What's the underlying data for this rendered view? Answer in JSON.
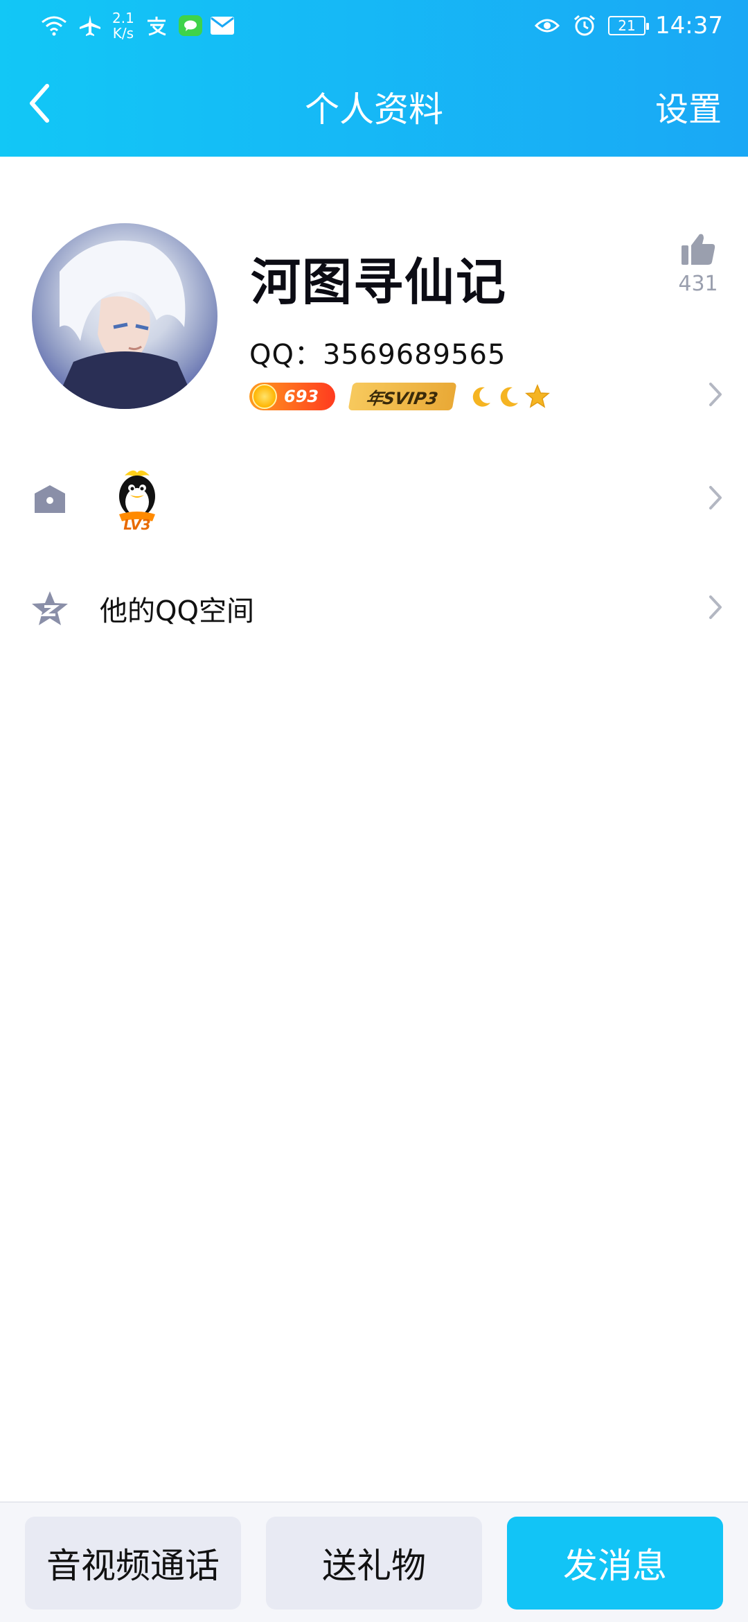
{
  "status_bar": {
    "net_speed_value": "2.1",
    "net_speed_unit": "K/s",
    "battery": "21",
    "time": "14:37",
    "icons_left": [
      "wifi-icon",
      "airplane-icon",
      "alipay-icon",
      "message-icon",
      "mail-icon"
    ],
    "icons_right": [
      "eye-icon",
      "alarm-icon",
      "battery-icon"
    ]
  },
  "navbar": {
    "title": "个人资料",
    "settings_label": "设置"
  },
  "profile": {
    "nickname": "河图寻仙记",
    "qq_label": "QQ：3569689565",
    "like_count": "431",
    "coin_badge": "693",
    "svip_badge": "年SVIP3",
    "level_icons": [
      "moon",
      "moon",
      "star"
    ]
  },
  "rows": {
    "qq_level_text": "LV3",
    "qzone_label": "他的QQ空间"
  },
  "bottom_bar": {
    "call_label": "音视频通话",
    "gift_label": "送礼物",
    "message_label": "发消息"
  },
  "colors": {
    "header_start": "#12c7f6",
    "header_end": "#1aa8f5",
    "primary_button": "#12c4f6",
    "secondary_button": "#e8eaf3",
    "muted_icon": "#9a9fae"
  }
}
